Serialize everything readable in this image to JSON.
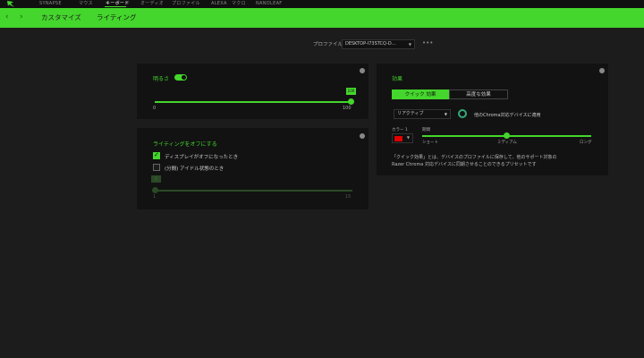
{
  "nav": {
    "items": [
      "SYNAPSE",
      "マウス",
      "キーボード",
      "オーディオ",
      "プロファイル",
      "ALEXA",
      "マクロ",
      "NANOLEAF"
    ],
    "active_index": 2
  },
  "subnav": {
    "back_icon": "chevron-left-icon",
    "forward_icon": "chevron-right-icon",
    "tabs": [
      "カスタマイズ",
      "ライティング"
    ],
    "active_index": 1
  },
  "profile": {
    "label": "プロファイル",
    "value": "DESKTOP-I73STCQ-D...",
    "more": "•••"
  },
  "brightness": {
    "title": "明るさ",
    "enabled": true,
    "min": "0",
    "max": "100",
    "value": 100,
    "tooltip": "100"
  },
  "lighting_off": {
    "title": "ライティングをオフにする",
    "option1": "ディスプレイがオフになったとき",
    "option1_checked": true,
    "option2": "(分間) アイドル状態のとき",
    "option2_checked": false,
    "idle_tooltip": "1",
    "idle_min": "1",
    "idle_max": "15",
    "idle_value": 1
  },
  "effects": {
    "title": "効果",
    "tab_quick": "クイック 効果",
    "tab_advanced": "高度な効果",
    "selected_effect": "リアクティブ",
    "apply_label": "他のChroma対応デバイスに適用",
    "color_label": "カラー 1",
    "color_hex": "#e00000",
    "duration_label": "期間",
    "duration_short": "ショート",
    "duration_medium": "ミディアム",
    "duration_long": "ロング",
    "duration_value": 0.5,
    "description": "「クイック効果」とは、デバイスのプロファイルに保存して、他のサポート対象の Razer Chroma 対応デバイスに同期させることのできるプリセットです"
  },
  "colors": {
    "accent": "#44d62c",
    "background": "#1c1c1c",
    "panel": "#121212"
  }
}
